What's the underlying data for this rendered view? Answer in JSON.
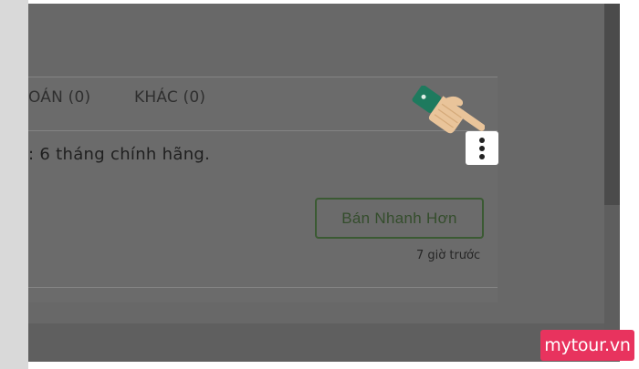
{
  "tabs": [
    {
      "label": "OÁN (0)"
    },
    {
      "label": "KHÁC (0)"
    }
  ],
  "post": {
    "description": ": 6 tháng chính hãng.",
    "action_button": "Bán Nhanh Hơn",
    "timestamp": "7 giờ trước"
  },
  "menu": {
    "icon": "three-dots-vertical-icon"
  },
  "pointer": {
    "icon": "pointing-hand-icon"
  },
  "watermark": {
    "text": "mytour.vn"
  },
  "colors": {
    "overlay": "#686868",
    "button_border": "#3b5a33",
    "watermark_bg": "#e8335e"
  }
}
